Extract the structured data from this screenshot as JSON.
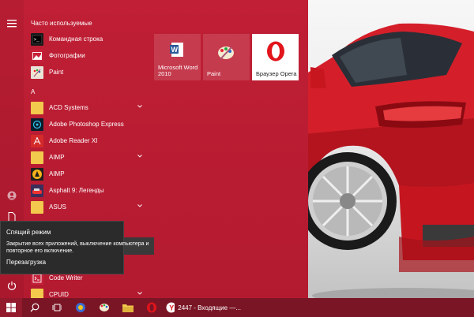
{
  "start_menu": {
    "frequent_header": "Часто используемые",
    "section_letter": "A",
    "frequent_apps": [
      {
        "label": "Командная строка",
        "icon": "command-prompt-icon"
      },
      {
        "label": "Фотографии",
        "icon": "photos-icon"
      },
      {
        "label": "Paint",
        "icon": "paint-icon"
      }
    ],
    "apps": [
      {
        "label": "ACD Systems",
        "icon": "folder-icon",
        "expandable": true
      },
      {
        "label": "Adobe Photoshop Express",
        "icon": "photoshop-express-icon",
        "expandable": false
      },
      {
        "label": "Adobe Reader XI",
        "icon": "adobe-reader-icon",
        "expandable": false
      },
      {
        "label": "AIMP",
        "icon": "folder-icon",
        "expandable": true
      },
      {
        "label": "AIMP",
        "icon": "aimp-icon",
        "expandable": false
      },
      {
        "label": "Asphalt 9: Легенды",
        "icon": "asphalt-icon",
        "expandable": false
      },
      {
        "label": "ASUS",
        "icon": "folder-icon",
        "expandable": true
      },
      {
        "label": "Code Writer",
        "icon": "code-writer-icon",
        "expandable": false
      },
      {
        "label": "CPUID",
        "icon": "folder-icon",
        "expandable": true
      }
    ],
    "tiles": [
      {
        "label": "Microsoft Word 2010",
        "icon": "word-icon"
      },
      {
        "label": "Paint",
        "icon": "paint-icon"
      },
      {
        "label": "Браузер Opera",
        "icon": "opera-icon"
      }
    ]
  },
  "power_tooltip": {
    "sleep_label": "Спящий режим",
    "description": "Закрытие всех приложений, выключение компьютера и повторное его включение.",
    "restart_label": "Перезагрузка"
  },
  "taskbar": {
    "mail_label": "2447 - Входящие —..."
  },
  "colors": {
    "menu_bg": "#c01f35",
    "taskbar_bg": "#7a1525",
    "car_red": "#d41f2a"
  }
}
